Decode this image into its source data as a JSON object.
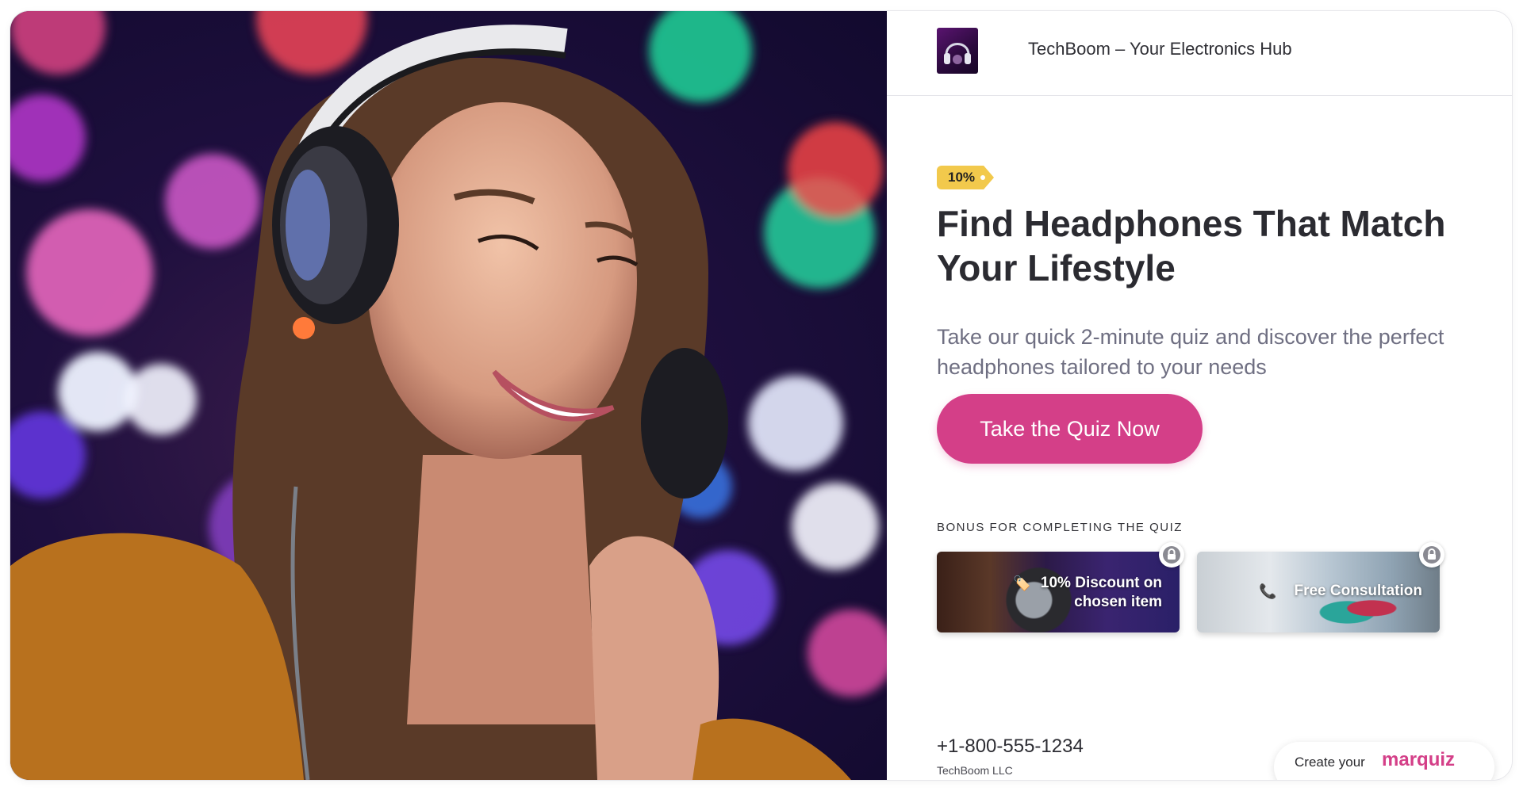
{
  "brand": {
    "title": "TechBoom – Your Electronics Hub",
    "logo_icon": "headphones-logo-icon"
  },
  "hero": {
    "image": "woman-wearing-headphones-photo"
  },
  "promo": {
    "badge": "10%",
    "headline": "Find Headphones That Match Your Lifestyle",
    "subhead": "Take our quick 2-minute quiz and discover the perfect headphones tailored to your needs",
    "cta_label": "Take the Quiz Now"
  },
  "bonus": {
    "heading": "BONUS FOR COMPLETING THE QUIZ",
    "items": [
      {
        "label": "10% Discount on chosen item",
        "emoji": "🏷️",
        "locked": true,
        "lock_icon": "lock-icon"
      },
      {
        "label": "Free Consultation",
        "emoji": "📞",
        "locked": true,
        "lock_icon": "lock-icon"
      }
    ]
  },
  "footer": {
    "phone": "+1-800-555-1234",
    "company": "TechBoom LLC",
    "marquiz_prefix": "Create your",
    "marquiz_brand": "marquiz"
  },
  "colors": {
    "accent": "#d43f88",
    "badge": "#f2c94c",
    "headline": "#2b2b31",
    "subhead": "#6f6f82"
  }
}
